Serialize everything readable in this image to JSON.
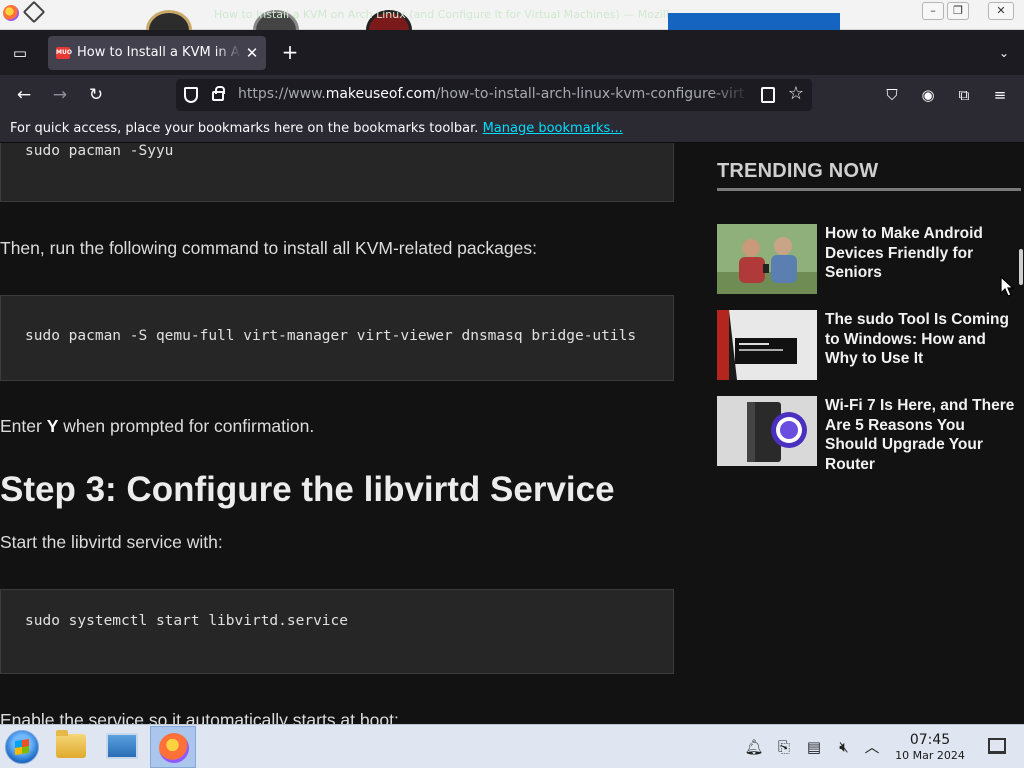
{
  "window": {
    "title": "How to Install a KVM on Arch Linux (and Configure It for Virtual Machines) — Mozilla Firefox",
    "minimize_label": "–",
    "maximize_label": "❐",
    "close_label": "✕"
  },
  "tabs": [
    {
      "favicon_text": "MUO",
      "title": "How to Install a KVM in Arch Linux",
      "close_label": "✕"
    }
  ],
  "tabbar": {
    "new_tab_label": "+",
    "list_all_tabs_label": "⌄",
    "firefox_view_label": "▭"
  },
  "navbar": {
    "back_label": "←",
    "forward_label": "→",
    "reload_label": "↻",
    "url_prefix": "https://www.",
    "url_domain": "makeuseof.com",
    "url_path": "/how-to-install-arch-linux-kvm-configure-virt",
    "bookmark_star": "☆",
    "pocket_label": "⛉",
    "account_label": "◉",
    "extensions_label": "⧉",
    "menu_label": "≡"
  },
  "bookmarks_bar": {
    "message": "For quick access, place your bookmarks here on the bookmarks toolbar.",
    "manage_link": "Manage bookmarks..."
  },
  "article": {
    "code_1": "sudo pacman -Syyu",
    "para_1": "Then, run the following command to install all KVM-related packages:",
    "code_2": "sudo pacman -S qemu-full virt-manager virt-viewer dnsmasq bridge-utils",
    "para_2_prefix": "Enter ",
    "para_2_bold": "Y",
    "para_2_suffix": " when prompted for confirmation.",
    "heading": "Step 3: Configure the libvirtd Service",
    "para_3": "Start the libvirtd service with:",
    "code_3": "sudo systemctl start libvirtd.service",
    "para_4": "Enable the service so it automatically starts at boot:"
  },
  "sidebar": {
    "title": "TRENDING NOW",
    "items": [
      {
        "title": "How to Make Android Devices Friendly for Seniors"
      },
      {
        "title": "The sudo Tool Is Coming to Windows: How and Why to Use It"
      },
      {
        "title": "Wi-Fi 7 Is Here, and There Are 5 Reasons You Should Upgrade Your Router"
      }
    ]
  },
  "taskbar": {
    "tray_icons": [
      "bell-icon",
      "usb-icon",
      "clipboard-icon",
      "mute-icon",
      "chevron-up-icon"
    ],
    "time": "07:45",
    "date": "10 Mar 2024"
  }
}
